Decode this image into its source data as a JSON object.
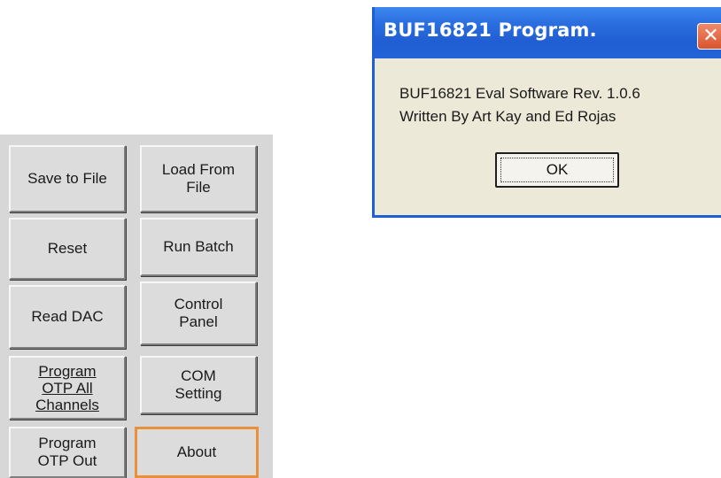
{
  "panel": {
    "buttons": {
      "save_to_file": "Save to File",
      "load_from_file": "Load From\nFile",
      "reset": "Reset",
      "run_batch": "Run Batch",
      "read_dac": "Read DAC",
      "control_panel": "Control\nPanel",
      "program_otp_all": "Program\nOTP All\nChannels",
      "com_setting": "COM\nSetting",
      "program_otp_out": "Program\nOTP Out",
      "about": "About"
    }
  },
  "dialog": {
    "title": "BUF16821 Program.",
    "close_glyph": "✕",
    "line1": "BUF16821 Eval Software  Rev. 1.0.6",
    "line2": "Written By Art Kay and Ed Rojas",
    "ok_label": "OK"
  },
  "colors": {
    "titlebar": "#1f5dd2",
    "dialog_bg": "#ece9d8",
    "focus_border": "#e8913a",
    "close_button": "#d9532f"
  }
}
